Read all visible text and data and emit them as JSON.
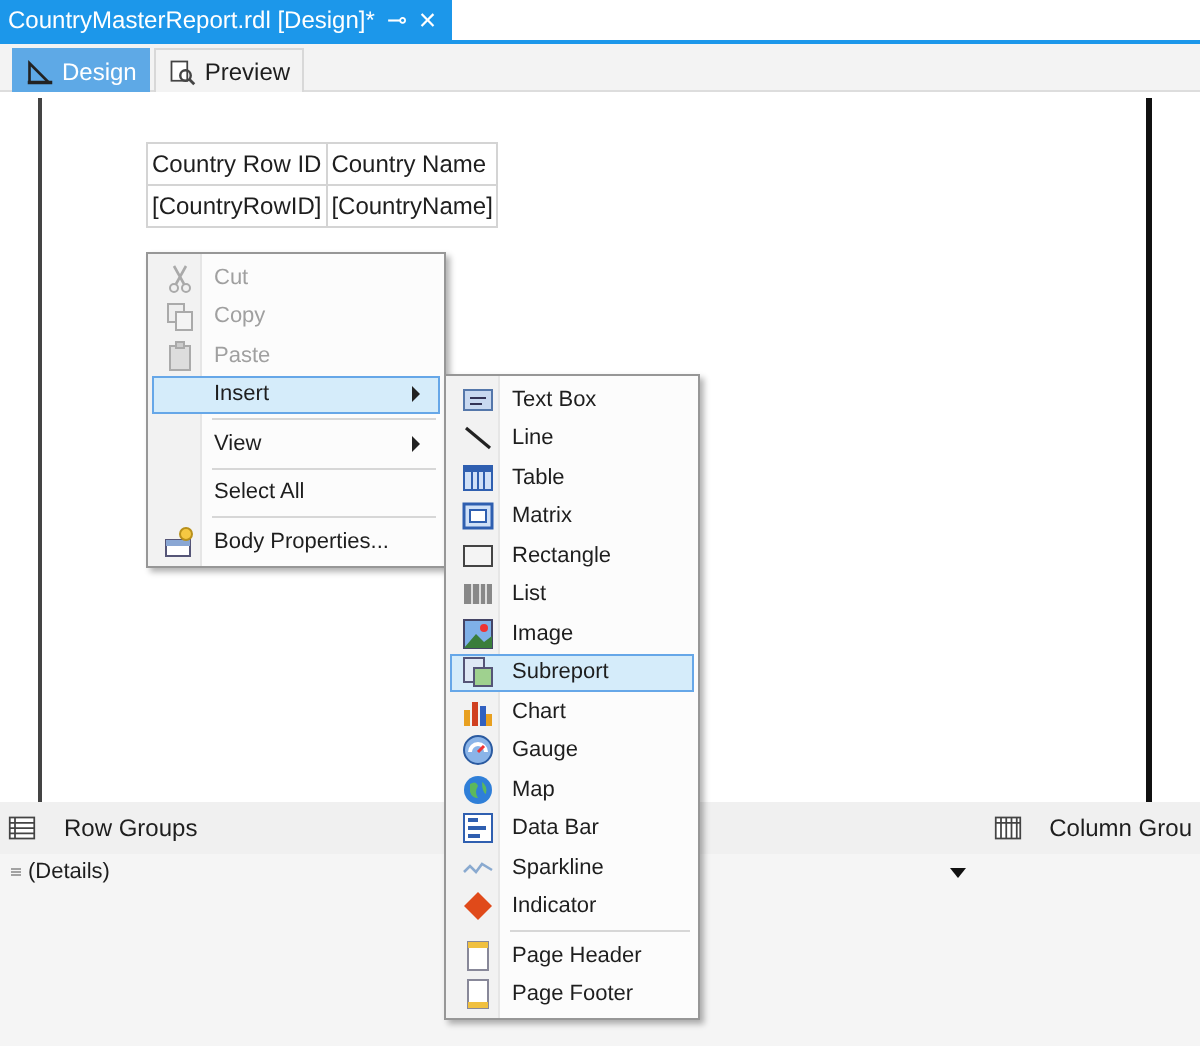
{
  "document_tab": {
    "title": "CountryMasterReport.rdl [Design]*",
    "pin": "⊸",
    "close": "×"
  },
  "view_tabs": [
    {
      "label": "Design",
      "selected": true
    },
    {
      "label": "Preview",
      "selected": false
    }
  ],
  "report_table": {
    "header": [
      "Country Row ID",
      "Country Name"
    ],
    "detail": [
      "[CountryRowID]",
      "[CountryName]"
    ]
  },
  "context_menu": {
    "items": [
      {
        "kind": "item",
        "label": "Cut",
        "disabled": true,
        "selected": false,
        "submenu": false
      },
      {
        "kind": "item",
        "label": "Copy",
        "disabled": true,
        "selected": false,
        "submenu": false
      },
      {
        "kind": "item",
        "label": "Paste",
        "disabled": true,
        "selected": false,
        "submenu": false
      },
      {
        "kind": "item",
        "label": "Insert",
        "disabled": false,
        "selected": true,
        "submenu": true
      },
      {
        "kind": "separator"
      },
      {
        "kind": "item",
        "label": "View",
        "disabled": false,
        "selected": false,
        "submenu": true
      },
      {
        "kind": "separator"
      },
      {
        "kind": "item",
        "label": "Select All",
        "disabled": false,
        "selected": false,
        "submenu": false
      },
      {
        "kind": "separator"
      },
      {
        "kind": "item",
        "label": "Body Properties...",
        "disabled": false,
        "selected": false,
        "submenu": false
      }
    ]
  },
  "insert_submenu": {
    "items": [
      {
        "kind": "item",
        "label": "Text Box",
        "selected": false
      },
      {
        "kind": "item",
        "label": "Line",
        "selected": false
      },
      {
        "kind": "item",
        "label": "Table",
        "selected": false
      },
      {
        "kind": "item",
        "label": "Matrix",
        "selected": false
      },
      {
        "kind": "item",
        "label": "Rectangle",
        "selected": false
      },
      {
        "kind": "item",
        "label": "List",
        "selected": false
      },
      {
        "kind": "item",
        "label": "Image",
        "selected": false
      },
      {
        "kind": "item",
        "label": "Subreport",
        "selected": true
      },
      {
        "kind": "item",
        "label": "Chart",
        "selected": false
      },
      {
        "kind": "item",
        "label": "Gauge",
        "selected": false
      },
      {
        "kind": "item",
        "label": "Map",
        "selected": false
      },
      {
        "kind": "item",
        "label": "Data Bar",
        "selected": false
      },
      {
        "kind": "item",
        "label": "Sparkline",
        "selected": false
      },
      {
        "kind": "item",
        "label": "Indicator",
        "selected": false
      },
      {
        "kind": "separator"
      },
      {
        "kind": "item",
        "label": "Page Header",
        "selected": false
      },
      {
        "kind": "item",
        "label": "Page Footer",
        "selected": false
      }
    ]
  },
  "row_groups": {
    "title": "Row Groups",
    "items": [
      "(Details)"
    ]
  },
  "column_groups": {
    "title": "Column Grou"
  }
}
